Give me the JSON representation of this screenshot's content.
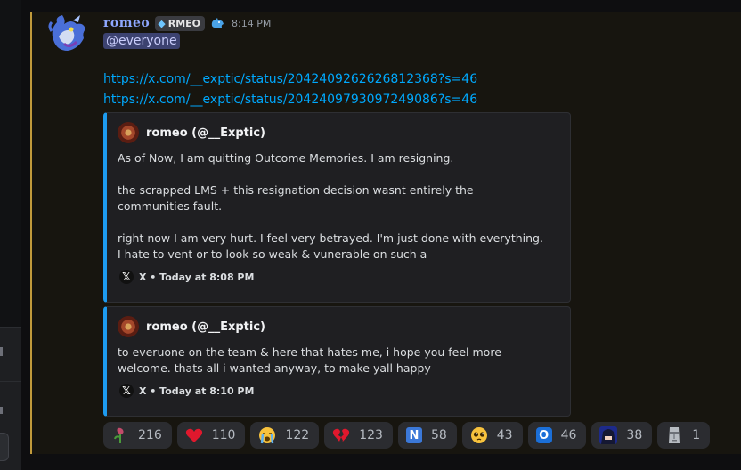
{
  "message": {
    "author": {
      "name": "romeo",
      "tag": "RMEO",
      "tag_icon": "gem-icon",
      "role_icon": "dragon-icon",
      "avatar_icon": "dragon-avatar"
    },
    "timestamp": "8:14 PM",
    "mention": "@everyone",
    "links": [
      "https://x.com/__exptic/status/2042409262626812368?s=46",
      "https://x.com/__exptic/status/2042409793097249086?s=46"
    ],
    "embeds": [
      {
        "author": "romeo (@__Exptic)",
        "paragraphs": [
          "As of Now, I am quitting Outcome Memories. I am resigning.",
          "the scrapped LMS + this resignation decision wasnt entirely the communities fault.",
          "right now I am very hurt. I feel very betrayed. I'm just done with everything. I hate to vent or to look so weak & vunerable on such a"
        ],
        "footer": "X • Today at 8:08 PM"
      },
      {
        "author": "romeo (@__Exptic)",
        "paragraphs": [
          "to everuone on the team & here that hates me, i hope you feel more welcome. thats all i wanted anyway, to make yall happy"
        ],
        "footer": "X • Today at 8:10 PM"
      }
    ],
    "reactions": [
      {
        "emoji": "rose-wilted-icon",
        "count": "216"
      },
      {
        "emoji": "red-heart-icon",
        "count": "110"
      },
      {
        "emoji": "sob-icon",
        "count": "122"
      },
      {
        "emoji": "broken-heart-icon",
        "count": "123"
      },
      {
        "emoji": "n-letter-icon",
        "glyph": "N",
        "count": "58"
      },
      {
        "emoji": "pleading-face-icon",
        "count": "43"
      },
      {
        "emoji": "o-letter-icon",
        "glyph": "O",
        "count": "46"
      },
      {
        "emoji": "anime-character-icon",
        "count": "38"
      },
      {
        "emoji": "moai-icon",
        "count": "1"
      }
    ]
  },
  "colors": {
    "accent_border": "#c19a3b",
    "username": "#8fa8ff",
    "link": "#00a8fc",
    "embed_border": "#1d9bf0",
    "mention_bg": "#3c4270"
  }
}
